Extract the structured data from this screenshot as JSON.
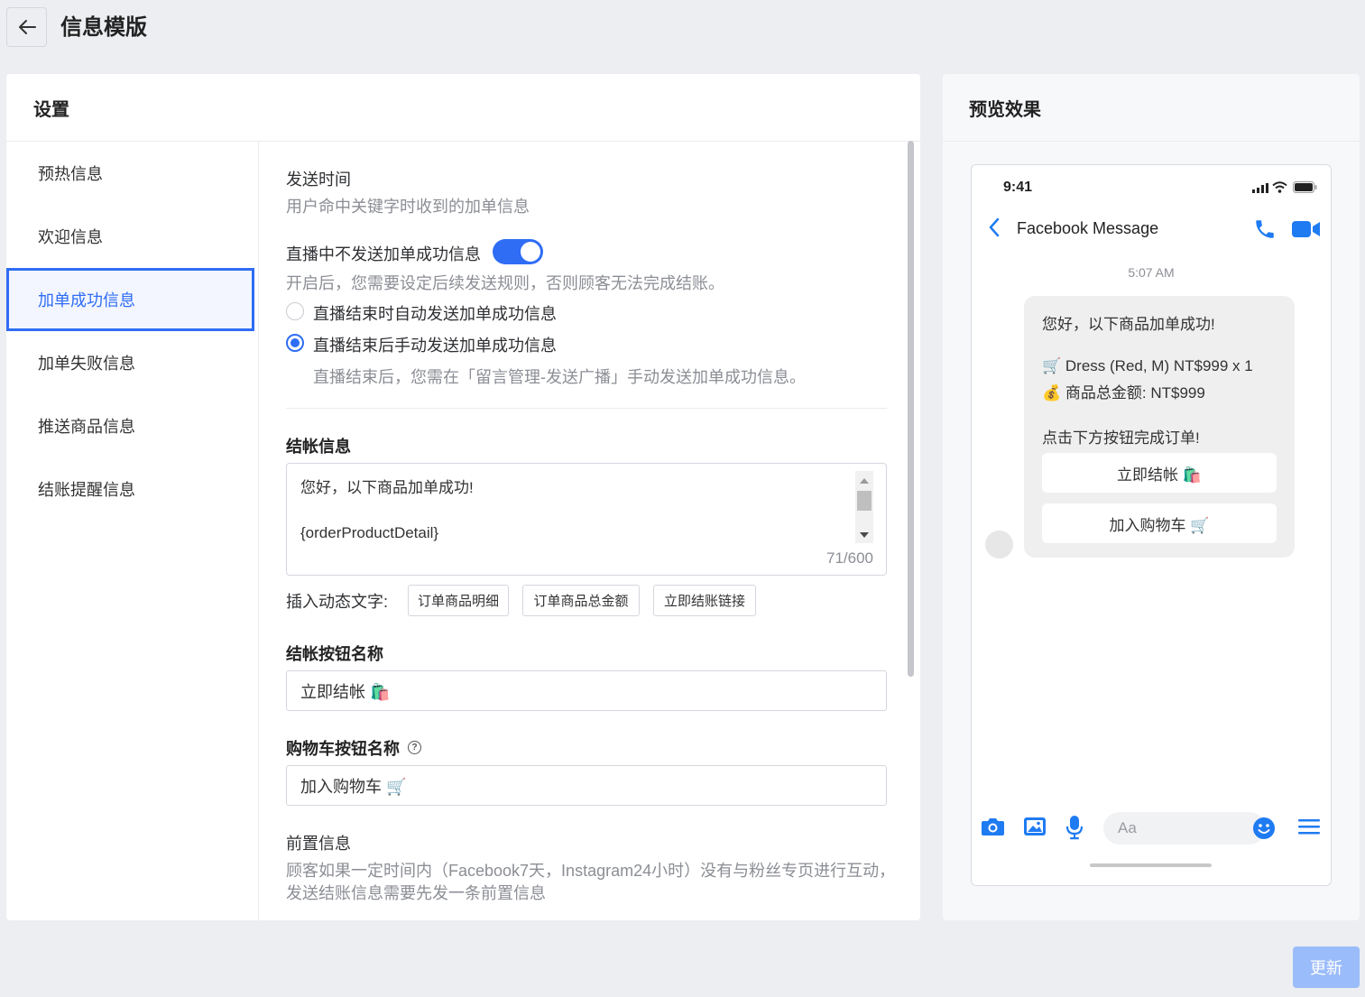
{
  "header": {
    "title": "信息模版"
  },
  "settings": {
    "title": "设置",
    "nav": [
      {
        "label": "预热信息"
      },
      {
        "label": "欢迎信息"
      },
      {
        "label": "加单成功信息"
      },
      {
        "label": "加单失败信息"
      },
      {
        "label": "推送商品信息"
      },
      {
        "label": "结账提醒信息"
      }
    ],
    "send_time": {
      "title": "发送时间",
      "desc": "用户命中关键字时收到的加单信息"
    },
    "live_toggle": {
      "label": "直播中不发送加单成功信息",
      "on": true,
      "hint": "开启后，您需要设定后续发送规则，否则顾客无法完成结账。"
    },
    "radio_auto": {
      "label": "直播结束时自动发送加单成功信息",
      "checked": false
    },
    "radio_manual": {
      "label": "直播结束后手动发送加单成功信息",
      "checked": true,
      "hint": "直播结束后，您需在「留言管理-发送广播」手动发送加单成功信息。"
    },
    "checkout_msg": {
      "title": "结帐信息",
      "line1": "您好，以下商品加单成功!",
      "line2": "{orderProductDetail}",
      "counter": "71/600"
    },
    "insert": {
      "label": "插入动态文字:",
      "chips": [
        "订单商品明细",
        "订单商品总金额",
        "立即结账链接"
      ]
    },
    "checkout_btn": {
      "title": "结帐按钮名称",
      "value": "立即结帐 🛍️"
    },
    "cart_btn": {
      "title": "购物车按钮名称",
      "help_icon": "question-circle-icon",
      "value": "加入购物车 🛒"
    },
    "pre_msg": {
      "title": "前置信息",
      "desc1": "顾客如果一定时间内（Facebook7天，Instagram24小时）没有与粉丝专页进行互动，",
      "desc2": "发送结账信息需要先发一条前置信息"
    }
  },
  "preview": {
    "title": "预览效果",
    "phone": {
      "time": "9:41",
      "chat_title": "Facebook Message",
      "msg_time": "5:07 AM",
      "lines": [
        "您好，以下商品加单成功!",
        "🛒 Dress (Red, M) NT$999 x 1",
        "💰 商品总金额: NT$999",
        "点击下方按钮完成订单!"
      ],
      "btn_checkout": "立即结帐 🛍️",
      "btn_cart": "加入购物车 🛒",
      "composer_placeholder": "Aa"
    }
  },
  "footer": {
    "update_label": "更新"
  },
  "colors": {
    "accent": "#2f6df5",
    "messenger_blue": "#1f7bf2",
    "update_disabled": "#9bbcfa"
  }
}
